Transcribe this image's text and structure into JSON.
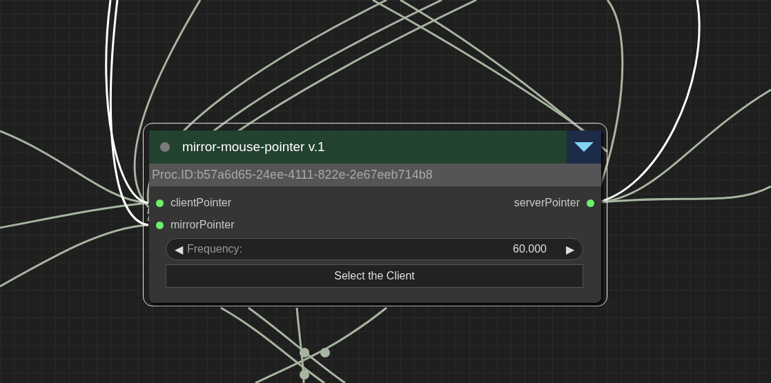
{
  "node": {
    "title": "mirror-mouse-pointer v.1",
    "proc_id": "Proc.ID:b57a6d65-24ee-4111-822e-2e67eeb714b8",
    "inputs": [
      {
        "name": "clientPointer"
      },
      {
        "name": "mirrorPointer"
      }
    ],
    "outputs": [
      {
        "name": "serverPointer"
      }
    ],
    "spinner": {
      "decrement": "◀",
      "label": "Frequency:",
      "value": "60.000",
      "increment": "▶"
    },
    "button": "Select the Client"
  }
}
